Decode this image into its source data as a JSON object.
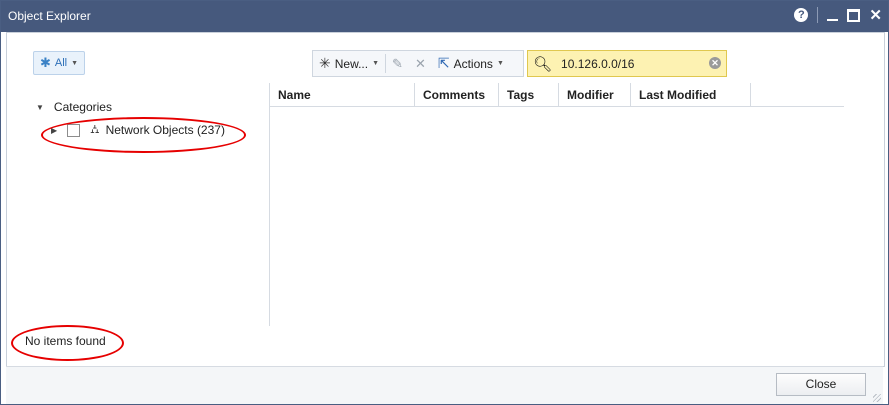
{
  "window": {
    "title": "Object Explorer"
  },
  "toolbar": {
    "filter_label": "All",
    "new_label": "New...",
    "actions_label": "Actions"
  },
  "search": {
    "value": "10.126.0.0/16"
  },
  "tree": {
    "root_label": "Categories",
    "items": [
      {
        "label": "Network Objects (237)"
      }
    ]
  },
  "grid": {
    "columns": [
      "Name",
      "Comments",
      "Tags",
      "Modifier",
      "Last Modified"
    ]
  },
  "status": {
    "text": "No items found"
  },
  "footer": {
    "close_label": "Close"
  },
  "colors": {
    "titlebar": "#46597d",
    "annotation": "#e60000",
    "search_bg": "#fdf2b2"
  }
}
